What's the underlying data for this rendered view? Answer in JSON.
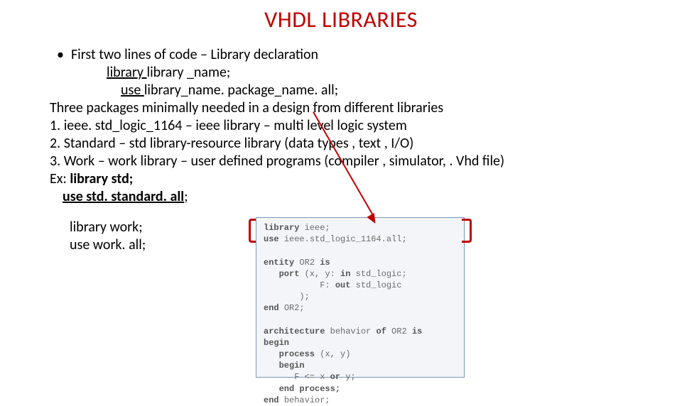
{
  "title": "VHDL LIBRARIES",
  "bullet1": "First two lines of code – Library declaration",
  "line_lib_kw": "library ",
  "line_lib_rest": "library _name;",
  "line_use_kw": "use ",
  "line_use_rest": "library_name. package_name. all;",
  "three_pkg": "Three packages minimally needed in a design from different libraries",
  "item1": "1.    ieee. std_logic_1164 – ieee library – multi level logic system",
  "item2": "2.    Standard – std library-resource library (data types , text , I/O)",
  "item3": "3.    Work – work library – user defined programs (compiler , simulator, . Vhd file)",
  "ex_prefix": "Ex: ",
  "ex_bold": "library std;",
  "ex2_bold": "use std. standard. all",
  "ex2_semi": ";",
  "work1": "library work;",
  "work2": "use work. all;",
  "code": {
    "l1a": "library ",
    "l1b": "ieee;",
    "l2a": "use ",
    "l2b": "ieee.std_logic_1164.all;",
    "l3": "",
    "l4a": "entity ",
    "l4b": "OR2 ",
    "l4c": "is",
    "l5a": "   port ",
    "l5b": "(x, y: ",
    "l5c": "in ",
    "l5d": "std_logic;",
    "l6": "           F: ",
    "l6b": "out ",
    "l6c": "std_logic",
    "l7": "       );",
    "l8a": "end ",
    "l8b": "OR2;",
    "l9": "",
    "l10a": "architecture ",
    "l10b": "behavior ",
    "l10c": "of ",
    "l10d": "OR2 ",
    "l10e": "is",
    "l11a": "begin",
    "l12a": "   process ",
    "l12b": "(x, y)",
    "l13": "   begin",
    "l14": "      F <= x ",
    "l14b": "or ",
    "l14c": "y;",
    "l15a": "   end process;",
    "l16a": "end ",
    "l16b": "behavior;"
  }
}
